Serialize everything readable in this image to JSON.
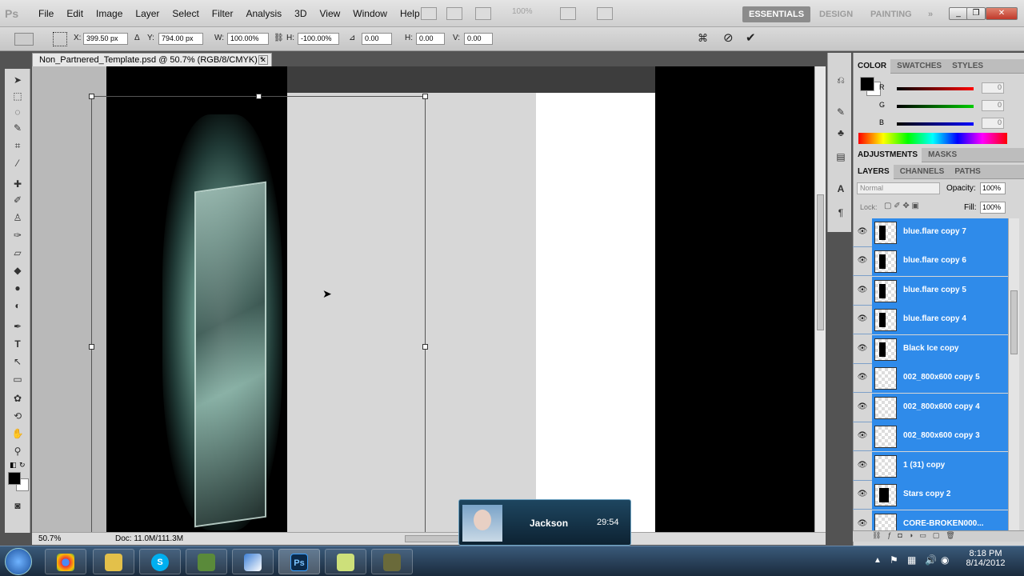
{
  "app": {
    "logo": "Ps"
  },
  "menu": [
    "File",
    "Edit",
    "Image",
    "Layer",
    "Select",
    "Filter",
    "Analysis",
    "3D",
    "View",
    "Window",
    "Help"
  ],
  "toolbar": {
    "zoom_display": "100%"
  },
  "workspaces": {
    "essentials": "ESSENTIALS",
    "design": "DESIGN",
    "painting": "PAINTING",
    "more": "»"
  },
  "options": {
    "x_label": "X:",
    "x_value": "399.50 px",
    "y_label": "Y:",
    "y_value": "794.00 px",
    "w_label": "W:",
    "w_value": "100.00%",
    "h_label": "H:",
    "h_value": "-100.00%",
    "rot_value": "0.00",
    "hskew_label": "H:",
    "hskew_value": "0.00",
    "vskew_label": "V:",
    "vskew_value": "0.00"
  },
  "document": {
    "tab_title": "Non_Partnered_Template.psd @ 50.7% (RGB/8/CMYK) *",
    "zoom": "50.7%",
    "doc_size": "Doc: 11.0M/111.3M"
  },
  "color_panel": {
    "tabs": [
      "COLOR",
      "SWATCHES",
      "STYLES"
    ],
    "channels": [
      {
        "label": "R",
        "value": "0",
        "color": "#e01010"
      },
      {
        "label": "G",
        "value": "0",
        "color": "#10b010"
      },
      {
        "label": "B",
        "value": "0",
        "color": "#1030e0"
      }
    ]
  },
  "adjust_panel": {
    "tabs": [
      "ADJUSTMENTS",
      "MASKS"
    ]
  },
  "layers_panel": {
    "tabs": [
      "LAYERS",
      "CHANNELS",
      "PATHS"
    ],
    "blend_mode": "Normal",
    "opacity_label": "Opacity:",
    "opacity_value": "100%",
    "lock_label": "Lock:",
    "fill_label": "Fill:",
    "fill_value": "100%",
    "layers": [
      {
        "name": "blue.flare copy 7"
      },
      {
        "name": "blue.flare copy 6"
      },
      {
        "name": "blue.flare copy 5"
      },
      {
        "name": "blue.flare copy 4"
      },
      {
        "name": "Black Ice copy"
      },
      {
        "name": "002_800x600 copy 5"
      },
      {
        "name": "002_800x600 copy 4"
      },
      {
        "name": "002_800x600 copy 3"
      },
      {
        "name": "1 (31) copy"
      },
      {
        "name": "Stars copy 2"
      },
      {
        "name": "CORE-BROKEN000..."
      }
    ]
  },
  "notification": {
    "name": "Jackson",
    "time": "29:54"
  },
  "taskbar": {
    "time": "8:18 PM",
    "date": "8/14/2012",
    "ps_label": "Ps"
  },
  "colors": {
    "selection_blue": "#2f8bea",
    "ui_gray": "#d6d6d6"
  }
}
